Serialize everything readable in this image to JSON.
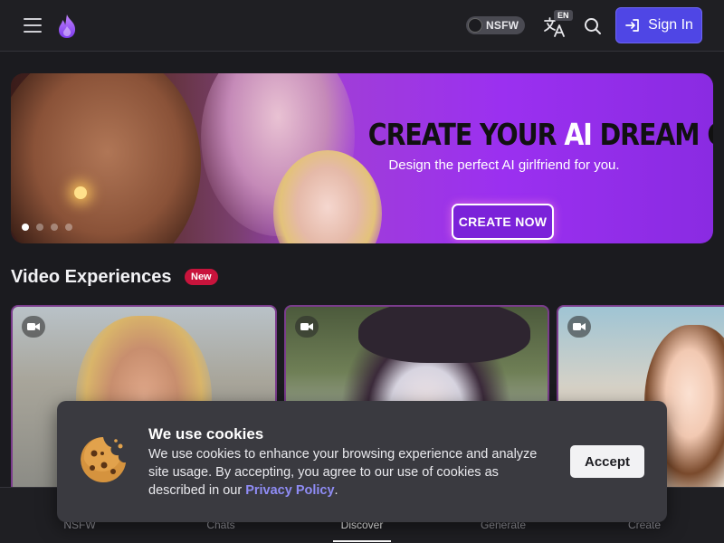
{
  "header": {
    "nsfw_label": "NSFW",
    "lang_badge": "EN",
    "signin_label": "Sign In"
  },
  "banner": {
    "title_pre": "CREATE YOUR ",
    "title_ai": "AI",
    "title_post": " DREAM GIRL",
    "subtitle": "Design the perfect AI girlfriend for you.",
    "cta": "CREATE NOW",
    "slide_count": 4,
    "active_slide": 1
  },
  "section": {
    "title": "Video Experiences",
    "badge": "New"
  },
  "cookie": {
    "title": "We use cookies",
    "text": "We use cookies to enhance your browsing experience and analyze site usage. By accepting, you agree to our use of cookies as described in our ",
    "link": "Privacy Policy",
    "after_link": ".",
    "accept": "Accept"
  },
  "nav": {
    "items": [
      {
        "label": "NSFW"
      },
      {
        "label": "Chats"
      },
      {
        "label": "Discover"
      },
      {
        "label": "Generate"
      },
      {
        "label": "Create"
      }
    ],
    "active": "Discover"
  },
  "colors": {
    "accent": "#4f46e5",
    "badge": "#c8143c",
    "link": "#8f8cf5"
  },
  "icons": [
    "menu-icon",
    "flame-logo-icon",
    "translate-icon",
    "search-icon",
    "sign-in-icon",
    "video-camera-icon",
    "cookie-icon"
  ]
}
